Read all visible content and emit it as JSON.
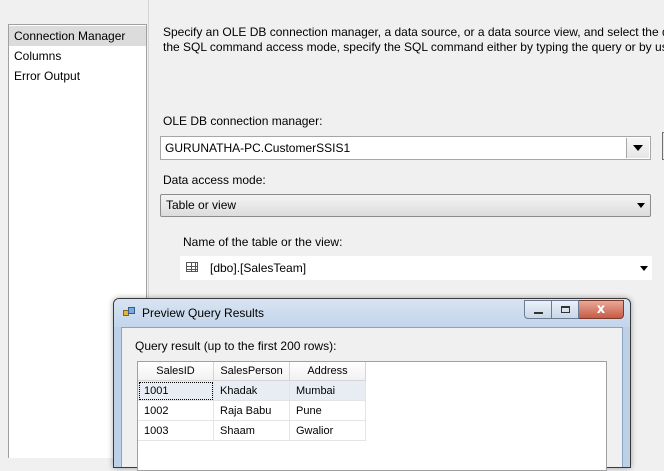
{
  "nav": {
    "items": [
      {
        "label": "Connection Manager",
        "selected": true
      },
      {
        "label": "Columns",
        "selected": false
      },
      {
        "label": "Error Output",
        "selected": false
      }
    ]
  },
  "description": {
    "line1": "Specify an OLE DB connection manager, a data source, or a data source view, and select the dat",
    "line2": "the SQL command access mode, specify the SQL command either by typing the query or by usi"
  },
  "connection": {
    "label": "OLE DB connection manager:",
    "value": "GURUNATHA-PC.CustomerSSIS1"
  },
  "access_mode": {
    "label": "Data access mode:",
    "value": "Table or view"
  },
  "table_name": {
    "label": "Name of the table or the view:",
    "value": "[dbo].[SalesTeam]"
  },
  "dialog": {
    "title": "Preview Query Results",
    "result_label": "Query result (up to the first 200 rows):",
    "close_glyph": "x",
    "columns": [
      "SalesID",
      "SalesPerson",
      "Address"
    ],
    "rows": [
      [
        "1001",
        "Khadak",
        "Mumbai"
      ],
      [
        "1002",
        "Raja Babu",
        "Pune"
      ],
      [
        "1003",
        "Shaam",
        "Gwalior"
      ]
    ]
  },
  "colors": {
    "dialog_frame": "#bcd0e8",
    "close_button": "#c75b45",
    "selected_row": "#e8edf4"
  }
}
